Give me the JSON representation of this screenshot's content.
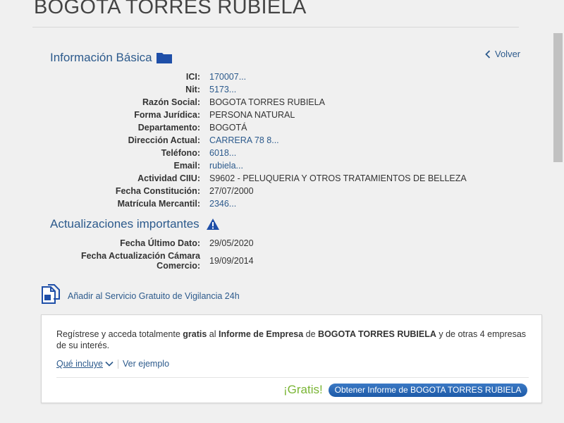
{
  "header": {
    "title": "BOGOTA TORRES RUBIELA"
  },
  "basic": {
    "title": "Información Básica",
    "back_label": "Volver",
    "rows": [
      {
        "label": "ICI:",
        "value": "170007..."
      },
      {
        "label": "Nit:",
        "value": "5173..."
      },
      {
        "label": "Razón Social:",
        "value": "BOGOTA TORRES RUBIELA"
      },
      {
        "label": "Forma Jurídica:",
        "value": "PERSONA NATURAL"
      },
      {
        "label": "Departamento:",
        "value": "BOGOTÁ"
      },
      {
        "label": "Dirección Actual:",
        "value": "CARRERA 78 8..."
      },
      {
        "label": "Teléfono:",
        "value": "6018..."
      },
      {
        "label": "Email:",
        "value": "rubiela..."
      },
      {
        "label": "Actividad CIIU:",
        "value": "S9602 - PELUQUERIA Y OTROS TRATAMIENTOS DE BELLEZA"
      },
      {
        "label": "Fecha Constitución:",
        "value": "27/07/2000"
      },
      {
        "label": "Matrícula Mercantil:",
        "value": "2346..."
      }
    ]
  },
  "updates": {
    "title": "Actualizaciones importantes",
    "rows": [
      {
        "label": "Fecha Último Dato:",
        "value": "29/05/2020"
      },
      {
        "label_line1": "Fecha Actualización Cámara",
        "label_line2": "Comercio:",
        "value": "19/09/2014"
      }
    ]
  },
  "vigilancia": {
    "label": "Añadir al Servicio Gratuito de Vigilancia 24h"
  },
  "offer": {
    "text_1": "Regístrese y acceda totalmente ",
    "text_bold_1": "gratis",
    "text_2": " al ",
    "text_bold_2": "Informe de Empresa",
    "text_3": " de ",
    "text_bold_3": "BOGOTA TORRES RUBIELA",
    "text_4": " y de otras 4 empresas de su interés.",
    "includes_label": "Qué incluye",
    "example_label": "Ver ejemplo",
    "gratis_label": "¡Gratis!",
    "cta_label": "Obtener Informe de BOGOTA TORRES RUBIELA"
  },
  "colors": {
    "link": "#2c5a8c",
    "gratis": "#7ab535",
    "button": "#2766b5"
  }
}
